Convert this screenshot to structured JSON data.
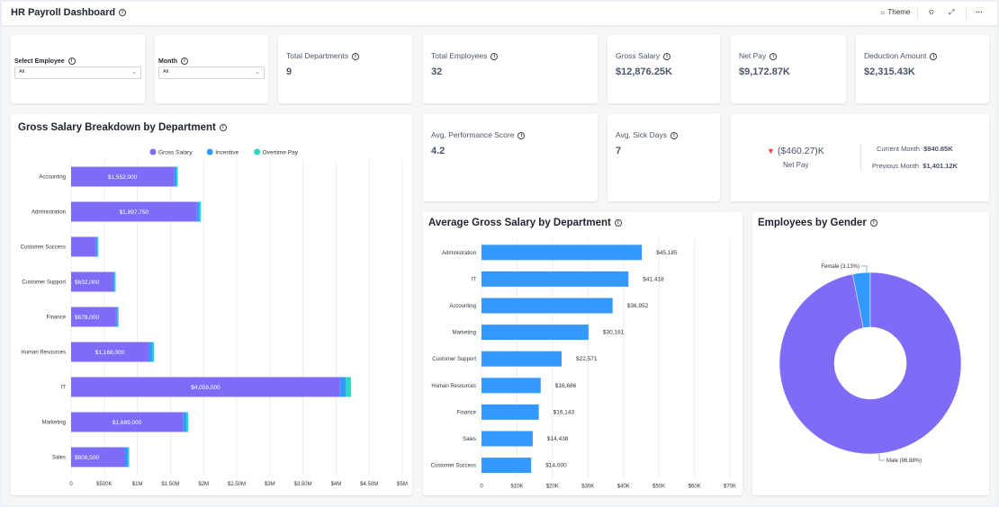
{
  "header": {
    "title": "HR Payroll Dashboard",
    "theme_label": "Theme",
    "icons": [
      "info-icon",
      "sun-icon",
      "glasses-icon",
      "expand-icon",
      "more-icon"
    ]
  },
  "filters": {
    "employee": {
      "label": "Select Employee",
      "value": "All"
    },
    "month": {
      "label": "Month",
      "value": "All"
    }
  },
  "kpis": [
    {
      "label": "Total Departments",
      "value": "9"
    },
    {
      "label": "Total Employees",
      "value": "32"
    },
    {
      "label": "Gross Salary",
      "value": "$12,876.25K"
    },
    {
      "label": "Net Pay",
      "value": "$9,172.87K"
    },
    {
      "label": "Deduction Amount",
      "value": "$2,315.43K"
    },
    {
      "label": "Avg. Performance Score",
      "value": "4.2"
    },
    {
      "label": "Avg. Sick Days",
      "value": "7"
    }
  ],
  "netpay_compare": {
    "delta": "($460.27)K",
    "label": "Net Pay",
    "current_label": "Current Month",
    "current_value": "$940.85K",
    "previous_label": "Previous Month",
    "previous_value": "$1,401.12K",
    "trend": "down",
    "trend_color": "#ef4444"
  },
  "colors": {
    "gross": "#7f6cf6",
    "incentive": "#3399ff",
    "overtime": "#2ad8c4",
    "bar": "#3399ff"
  },
  "chart_data": [
    {
      "type": "bar",
      "orientation": "horizontal",
      "stacked": true,
      "title": "Gross Salary Breakdown by Department",
      "legend": "top",
      "categories": [
        "Accounting",
        "Administration",
        "Customer Success",
        "Customer Support",
        "Finance",
        "Human Resources",
        "IT",
        "Marketing",
        "Sales"
      ],
      "series": [
        {
          "name": "Gross Salary",
          "values": [
            1552000,
            1897750,
            378000,
            632000,
            678000,
            1168000,
            4059000,
            1689000,
            808500
          ],
          "labels": [
            "$1,552,000",
            "$1,897,750",
            "",
            "$632,000",
            "$678,000",
            "$1,168,000",
            "$4,059,000",
            "$1,689,000",
            "$808,500"
          ]
        },
        {
          "name": "Incentive",
          "values": [
            40000,
            40000,
            20000,
            25000,
            25000,
            60000,
            90000,
            55000,
            50000
          ]
        },
        {
          "name": "Overtime Pay",
          "values": [
            20000,
            20000,
            15000,
            15000,
            15000,
            25000,
            75000,
            25000,
            20000
          ]
        }
      ],
      "xlim": [
        0,
        5000000
      ],
      "xticks": [
        "0",
        "$500K",
        "$1M",
        "$1.50M",
        "$2M",
        "$2.50M",
        "$3M",
        "$3.50M",
        "$4M",
        "$4.50M",
        "$5M"
      ],
      "grid": true
    },
    {
      "type": "bar",
      "orientation": "horizontal",
      "title": "Average Gross Salary by Department",
      "categories": [
        "Administration",
        "IT",
        "Accounting",
        "Marketing",
        "Customer Support",
        "Human Resources",
        "Finance",
        "Sales",
        "Customer Success"
      ],
      "values": [
        45185,
        41418,
        36952,
        30161,
        22571,
        16686,
        16143,
        14438,
        14000
      ],
      "labels": [
        "$45,185",
        "$41,418",
        "$36,952",
        "$30,161",
        "$22,571",
        "$16,686",
        "$16,143",
        "$14,438",
        "$14,000"
      ],
      "xlim": [
        0,
        70000
      ],
      "xticks": [
        "0",
        "$10K",
        "$20K",
        "$30K",
        "$40K",
        "$50K",
        "$60K",
        "$70K"
      ],
      "grid": true
    },
    {
      "type": "pie",
      "donut": true,
      "title": "Employees by Gender",
      "slices": [
        {
          "name": "Female",
          "value": 3.13,
          "label": "Female (3.13%)",
          "color": "#3399ff"
        },
        {
          "name": "Male",
          "value": 96.88,
          "label": "Male (96.88%)",
          "color": "#7f6cf6"
        }
      ]
    }
  ]
}
